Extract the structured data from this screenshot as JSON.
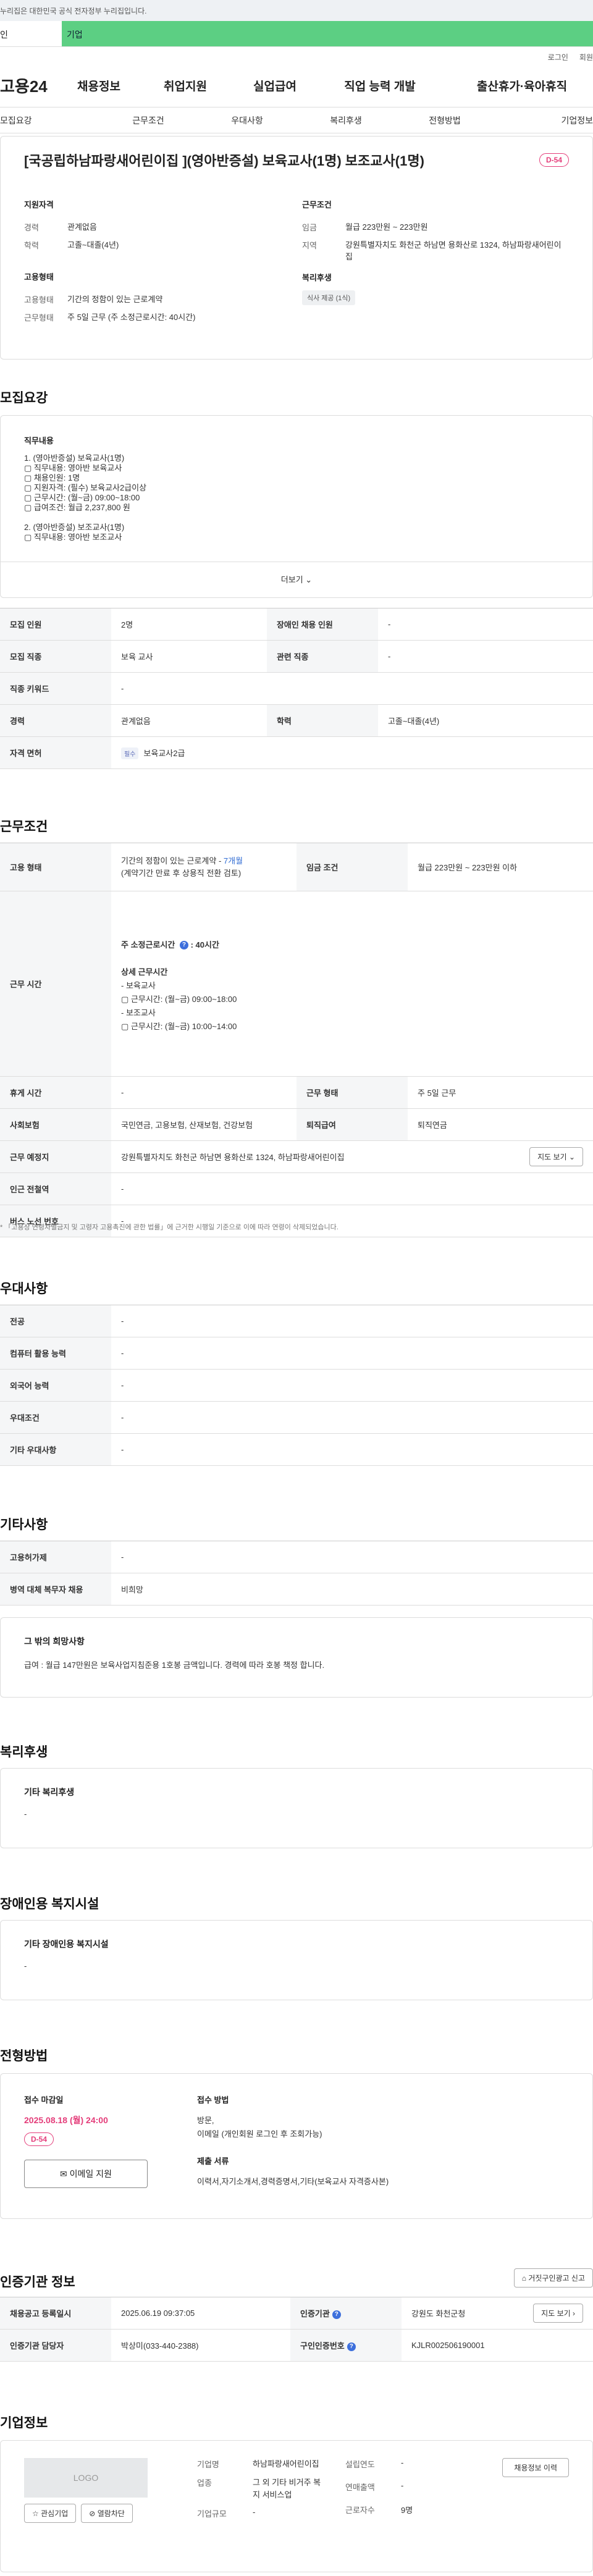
{
  "gov_banner": "누리집은 대한민국 공식 전자정부 누리집입니다.",
  "user_tabs": [
    "인",
    "기업"
  ],
  "util": [
    "로그인",
    "회원"
  ],
  "logo": "고용24",
  "gnb": [
    "채용정보",
    "취업지원",
    "실업급여",
    "직업 능력 개발",
    "출산휴가·육아휴직"
  ],
  "subnav": [
    "모집요강",
    "근무조건",
    "우대사항",
    "복리후생",
    "전형방법",
    "기업정보"
  ],
  "title": "[국공립하남파랑새어린이집 ](영아반증설) 보육교사(1명) 보조교사(1명)",
  "dday": "D-54",
  "summary": {
    "qual_title": "지원자격",
    "qual": [
      {
        "k": "경력",
        "v": "관계없음"
      },
      {
        "k": "학력",
        "v": "고졸~대졸(4년)"
      }
    ],
    "cond_title": "근무조건",
    "cond": [
      {
        "k": "임금",
        "v": "월급 223만원 ~ 223만원"
      },
      {
        "k": "지역",
        "v": "강원특별자치도 화천군 하남면 용화산로 1324, 하남파랑새어린이집"
      }
    ],
    "emp_title": "고용형태",
    "emp": [
      {
        "k": "고용형태",
        "v": "기간의 정함이 있는 근로계약"
      },
      {
        "k": "근무형태",
        "v": "주 5일 근무 (주 소정근로시간: 40시간)"
      }
    ],
    "welfare_title": "복리후생",
    "welfare_chip": "식사 제공 (1식)"
  },
  "s_recruit": "모집요강",
  "job_desc": {
    "title": "직무내용",
    "lines": [
      "1. (영아반증설) 보육교사(1명)",
      "▢ 직무내용: 영아반 보육교사",
      "▢ 채용인원: 1명",
      "▢ 지원자격: (필수) 보육교사2급이상",
      "▢ 근무시간: (월~금) 09:00~18:00",
      "▢ 급여조건: 월급 2,237,800 원",
      "",
      "2. (영아반증설) 보조교사(1명)",
      "▢ 직무내용: 영아반 보조교사"
    ],
    "more": "더보기"
  },
  "recruit_table": [
    [
      "모집 인원",
      "2명",
      "장애인 채용 인원",
      "-"
    ],
    [
      "모집 직종",
      "보육 교사",
      "관련 직종",
      "-"
    ],
    [
      "직종 키워드",
      "-"
    ],
    [
      "경력",
      "관계없음",
      "학력",
      "고졸~대졸(4년)"
    ],
    [
      "자격 면허",
      "필수",
      "보육교사2급"
    ]
  ],
  "s_work": "근무조건",
  "work": {
    "emp_type_label": "고용 형태",
    "emp_type": "기간의 정함이 있는 근로계약",
    "emp_months": "7개월",
    "emp_sub": "(계약기간 만료 후 상용직 전환 검토)",
    "wage_label": "임금 조건",
    "wage": "월급 223만원 ~ 223만원 이하",
    "hours_label": "근무 시간",
    "hours_week": "주 소정근로시간",
    "hours_val": ": 40시간",
    "hours_detail_title": "상세 근무시간",
    "hours_detail": [
      "- 보육교사",
      "▢ 근무시간: (월~금) 09:00~18:00",
      "- 보조교사",
      "▢ 근무시간: (월~금) 10:00~14:00"
    ],
    "rest_label": "휴게 시간",
    "rest": "-",
    "form_label": "근무 형태",
    "form": "주 5일 근무",
    "ins_label": "사회보험",
    "ins": "국민연금, 고용보험, 산재보험, 건강보험",
    "sev_label": "퇴직급여",
    "sev": "퇴직연금",
    "loc_label": "근무 예정지",
    "loc": "강원특별자치도 화천군 하남면 용화산로 1324, 하남파랑새어린이집",
    "map_btn": "지도 보기",
    "subway_label": "인근 전철역",
    "subway": "-",
    "bus_label": "버스 노선 번호",
    "bus": "-",
    "note": "「고용상 연령차별금지 및 고령자 고용촉진에 관한 법률」에 근거한 시행일 기준으로 이에 따라 연령이 삭제되었습니다."
  },
  "s_pref": "우대사항",
  "pref": [
    [
      "전공",
      "-"
    ],
    [
      "컴퓨터 활용 능력",
      "-"
    ],
    [
      "외국어 능력",
      "-"
    ],
    [
      "우대조건",
      "-"
    ],
    [
      "기타 우대사항",
      "-"
    ]
  ],
  "s_etc": "기타사항",
  "etc": [
    [
      "고용허가제",
      "-"
    ],
    [
      "병역 대체 복무자 채용",
      "비희망"
    ]
  ],
  "etc_card": {
    "title": "그 밖의 희망사항",
    "text": "급여 : 월급 147만원은 보육사업지침준용 1호봉 금액입니다. 경력에 따라 호봉 책정 합니다."
  },
  "s_welfare": "복리후생",
  "welfare_card": {
    "title": "기타 복리후생",
    "text": "-"
  },
  "s_disabled": "장애인용 복지시설",
  "disabled_card": {
    "title": "기타 장애인용 복지시설",
    "text": "-"
  },
  "s_method": "전형방법",
  "method": {
    "deadline_title": "접수 마감일",
    "deadline": "2025.08.18 (월) 24:00",
    "dday": "D-54",
    "email_btn": "이메일 지원",
    "apply_title": "접수 방법",
    "apply": [
      "방문,",
      "이메일 (개인회원 로그인 후 조회가능)"
    ],
    "docs_title": "제출 서류",
    "docs": "이력서,자기소개서,경력증명서,기타(보육교사 자격증사본)"
  },
  "s_cert": "인증기관 정보",
  "report_btn": "거짓구인광고 신고",
  "cert": {
    "reg_label": "채용공고 등록일시",
    "reg": "2025.06.19 09:37:05",
    "org_label": "인증기관",
    "org": "강원도 화천군청",
    "map_btn": "지도 보기",
    "mgr_label": "인증기관 담당자",
    "mgr": "박상미(033-440-2388)",
    "num_label": "구인인증번호",
    "num": "KJLR002506190001"
  },
  "s_company": "기업정보",
  "company": {
    "logo": "LOGO",
    "fav_btn": "관심기업",
    "block_btn": "열람차단",
    "name_label": "기업명",
    "name": "하남파랑새어린이집",
    "ind_label": "업종",
    "ind": "그 외 기타 비거주 복지 서비스업",
    "size_label": "기업규모",
    "size": "-",
    "found_label": "설립연도",
    "found": "-",
    "sales_label": "연매출액",
    "sales": "-",
    "emp_label": "근로자수",
    "emp": "9명",
    "jobs_btn": "채용정보 이력"
  }
}
